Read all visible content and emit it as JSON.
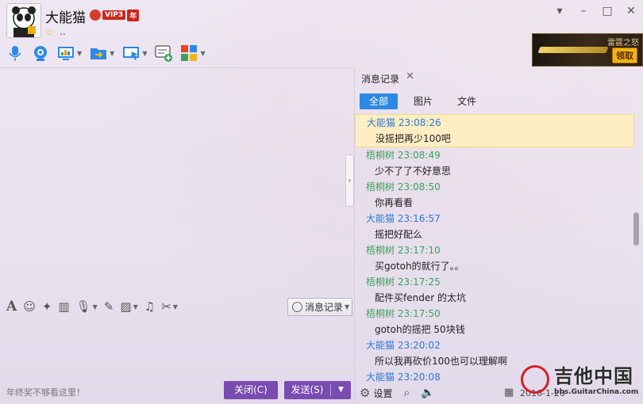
{
  "contact": {
    "name": "大能猫",
    "vip_label": "VIP3",
    "vip_suffix": "年",
    "signature": ".."
  },
  "window_controls": {
    "skin": "👕",
    "minimize": "–",
    "maximize": "□",
    "close": "✕"
  },
  "toolbar_icons": [
    "mic-icon",
    "video-call-icon",
    "remote-desktop-icon",
    "send-file-icon",
    "screen-share-icon",
    "message-add-icon",
    "apps-icon"
  ],
  "ad": {
    "title": "雷霆之怒",
    "button": "领取"
  },
  "input_toolbar": {
    "icons": [
      "font-icon",
      "emoji-icon",
      "magic-icon",
      "gif-icon",
      "voice-icon",
      "edit-icon",
      "image-icon",
      "music-icon",
      "scissors-icon"
    ],
    "history_label": "消息记录"
  },
  "bottom": {
    "hint": "年终奖不够看这里！",
    "close_label": "关闭(C)",
    "send_label": "发送(S)"
  },
  "history": {
    "tab_label": "消息记录",
    "filters": [
      "全部",
      "图片",
      "文件"
    ],
    "messages": [
      {
        "sender": "大能猫",
        "time": "23:08:26",
        "text": "没摇把再少100吧",
        "color": "#2b79d6",
        "highlight": true
      },
      {
        "sender": "梧桐树",
        "time": "23:08:49",
        "text": "少不了了不好意思",
        "color": "#3aa35b"
      },
      {
        "sender": "梧桐树",
        "time": "23:08:50",
        "text": "你再看看",
        "color": "#3aa35b"
      },
      {
        "sender": "大能猫",
        "time": "23:16:57",
        "text": "摇把好配么",
        "color": "#2b79d6"
      },
      {
        "sender": "梧桐树",
        "time": "23:17:10",
        "text": "买gotoh的就行了。。",
        "color": "#3aa35b"
      },
      {
        "sender": "梧桐树",
        "time": "23:17:25",
        "text": "配件买fender 的太坑",
        "color": "#3aa35b"
      },
      {
        "sender": "梧桐树",
        "time": "23:17:50",
        "text": "gotoh的摇把 50块钱",
        "color": "#3aa35b"
      },
      {
        "sender": "大能猫",
        "time": "23:20:02",
        "text": "所以我再砍价100也可以理解啊",
        "color": "#2b79d6"
      },
      {
        "sender": "大能猫",
        "time": "23:20:08",
        "text": "",
        "color": "#2b79d6"
      }
    ],
    "footer": {
      "settings_label": "设置",
      "date": "2016-1-20"
    }
  },
  "watermark": {
    "brand": "吉他中国",
    "url": "bbs.GuitarChina.com"
  }
}
